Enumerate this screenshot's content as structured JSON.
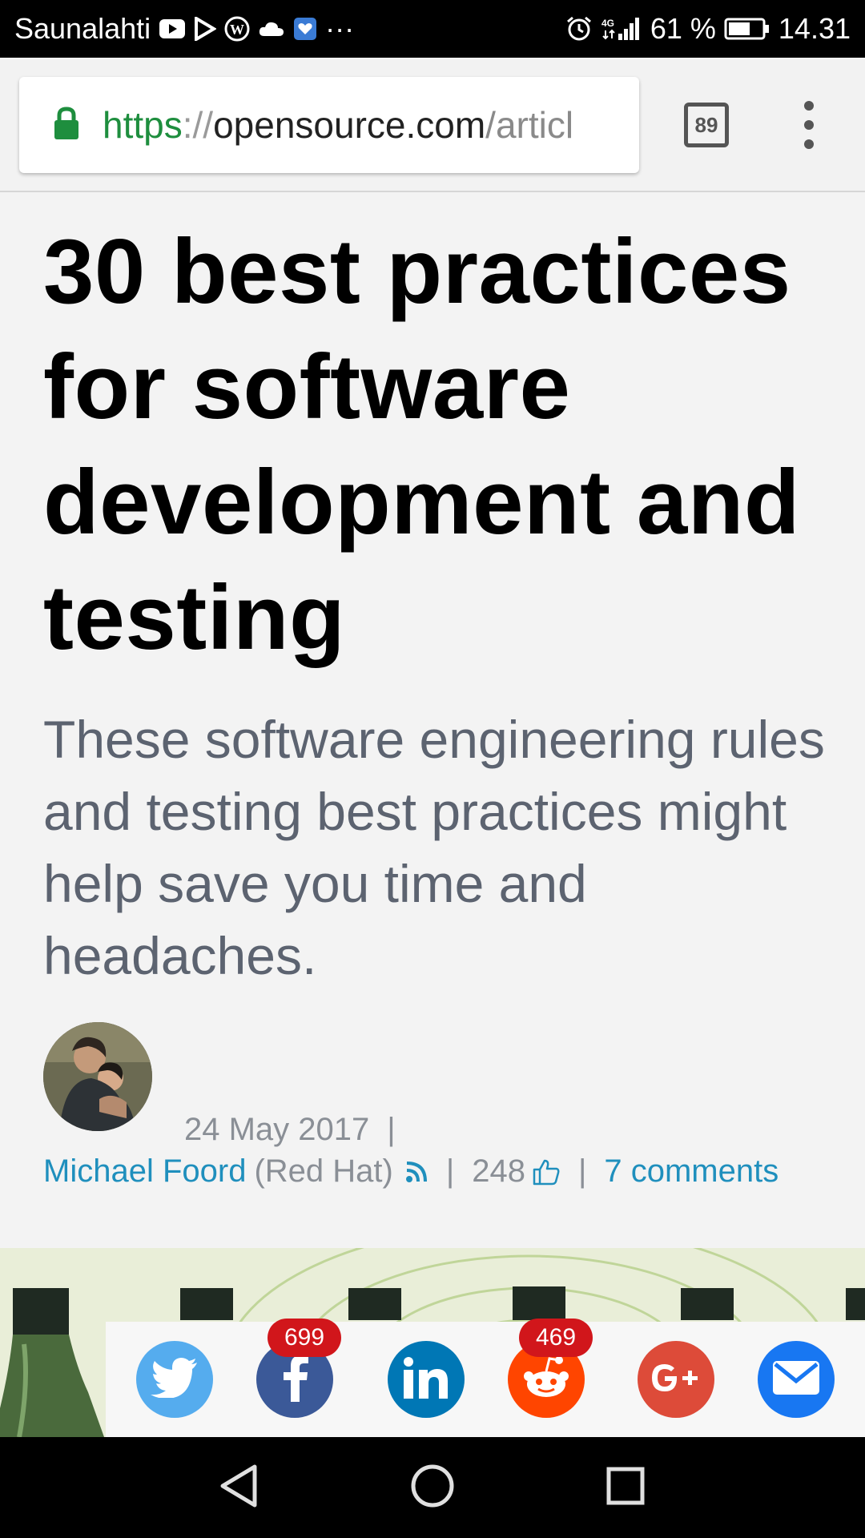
{
  "status_bar": {
    "carrier": "Saunalahti",
    "more": "···",
    "network": "4G",
    "battery": "61 %",
    "time": "14.31"
  },
  "browser": {
    "url_scheme": "https",
    "url_sep": "://",
    "url_host": "opensource.com",
    "url_path": "/articl",
    "tab_count": "89"
  },
  "article": {
    "headline": "30 best practices for software development and testing",
    "lead": "These software engineering rules and testing best practices might help save you time and headaches.",
    "date": "24 May 2017",
    "author": "Michael Foord",
    "organization": "(Red Hat)",
    "likes": "248",
    "comments": "7 comments"
  },
  "share": {
    "facebook_count": "699",
    "reddit_count": "469",
    "colors": {
      "twitter": "#55acee",
      "facebook": "#3b5998",
      "linkedin": "#0077b5",
      "reddit": "#ff4500",
      "googleplus": "#dd4b39",
      "email": "#1877f2"
    }
  }
}
